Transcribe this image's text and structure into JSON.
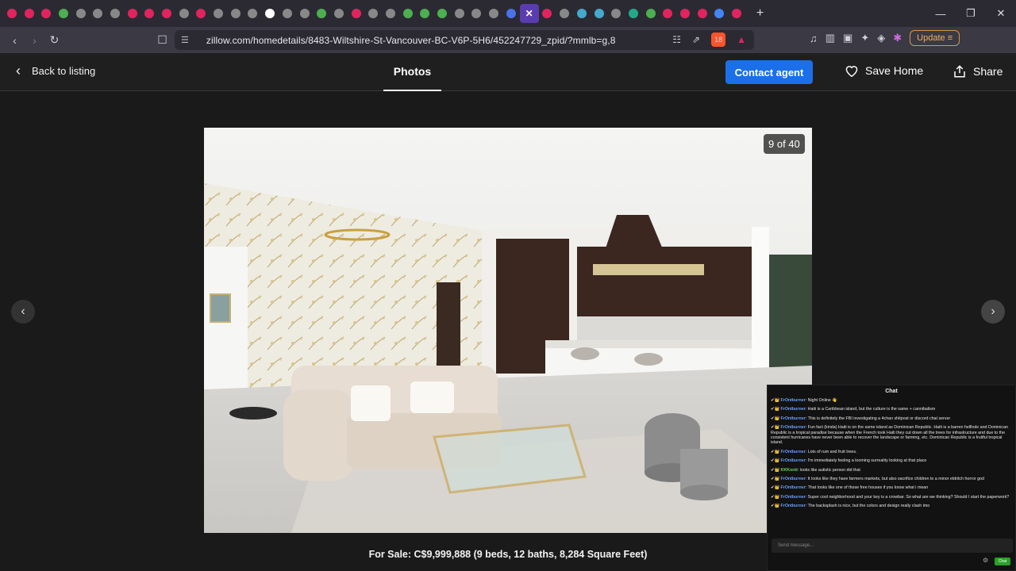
{
  "browser": {
    "tab_icons": [
      "#e0245e",
      "#e0245e",
      "#e0245e",
      "#4caf50",
      "#888",
      "#888",
      "#888",
      "#e0245e",
      "#e0245e",
      "#e0245e",
      "#888",
      "#e0245e",
      "#888",
      "#888",
      "#888",
      "#fff",
      "#888",
      "#888",
      "#4caf50",
      "#888",
      "#e0245e",
      "#888",
      "#888",
      "#4caf50",
      "#4caf50",
      "#4caf50",
      "#888",
      "#888",
      "#888",
      "#4a72e8"
    ],
    "active_tab_close": "✕",
    "trailing_tab_icons": [
      "#e0245e",
      "#888",
      "#4ac",
      "#4ac",
      "#888",
      "#2a8",
      "#4caf50",
      "#e0245e",
      "#e0245e",
      "#e0245e",
      "#4285f4",
      "#e0245e"
    ],
    "new_tab": "+",
    "window_controls": [
      "—",
      "❐",
      "✕"
    ],
    "url": "zillow.com/homedetails/8483-Wiltshire-St-Vancouver-BC-V6P-5H6/452247729_zpid/?mmlb=g,8",
    "update_label": "Update",
    "brave_badge": "18",
    "rewards_badge": "1"
  },
  "header": {
    "back_label": "Back to listing",
    "tab_label": "Photos",
    "contact_label": "Contact agent",
    "save_label": "Save Home",
    "share_label": "Share"
  },
  "gallery": {
    "counter": "9 of 40",
    "caption": "For Sale: C$9,999,888 (9 beds, 12 baths, 8,284 Square Feet)"
  },
  "chat": {
    "title": "Chat",
    "messages": [
      {
        "user": "FrOntburner",
        "text": "Night Online 👋"
      },
      {
        "user": "FrOntburner",
        "text": "Haiti is a Caribbean island, but the culture is the same + cannibalism"
      },
      {
        "user": "FrOntburner",
        "text": "This is definitely the FBI investigating a 4chan shitpost or discord chat server"
      },
      {
        "user": "FrOntburner",
        "text": "Fun fact (kinda) Haiti is on the same island as Dominican Republic. Haiti is a barren hellhole and Dominican Republic is a tropical paradise because when the French took Haiti they cut down all the trees for infrastructure and due to the consistent hurricanes have never been able to recover the landscape or farming, etc. Dominican Republic is a fruitful tropical island."
      },
      {
        "user": "FrOntburner",
        "text": "Lots of rum and fruit trees."
      },
      {
        "user": "FrOntburner",
        "text": "I'm immediately feeling a looming surreality looking at that place"
      },
      {
        "user": "KKKonti",
        "text": "looks like autistic person did that"
      },
      {
        "user": "FrOntburner",
        "text": "It looks like they have farmers markets, but also sacrifice children to a minor eldritch horror god"
      },
      {
        "user": "FrOntburner",
        "text": "That looks like one of those free houses if you know what i mean"
      },
      {
        "user": "FrOntburner",
        "text": "Super cool neighborhood and your key is a crowbar. So what are we thinking? Should I start the paperwork?"
      },
      {
        "user": "FrOntburner",
        "text": "The backsplash is nice, but the colors and design really clash imo"
      }
    ],
    "input_placeholder": "Send message...",
    "send_label": "Chat"
  }
}
